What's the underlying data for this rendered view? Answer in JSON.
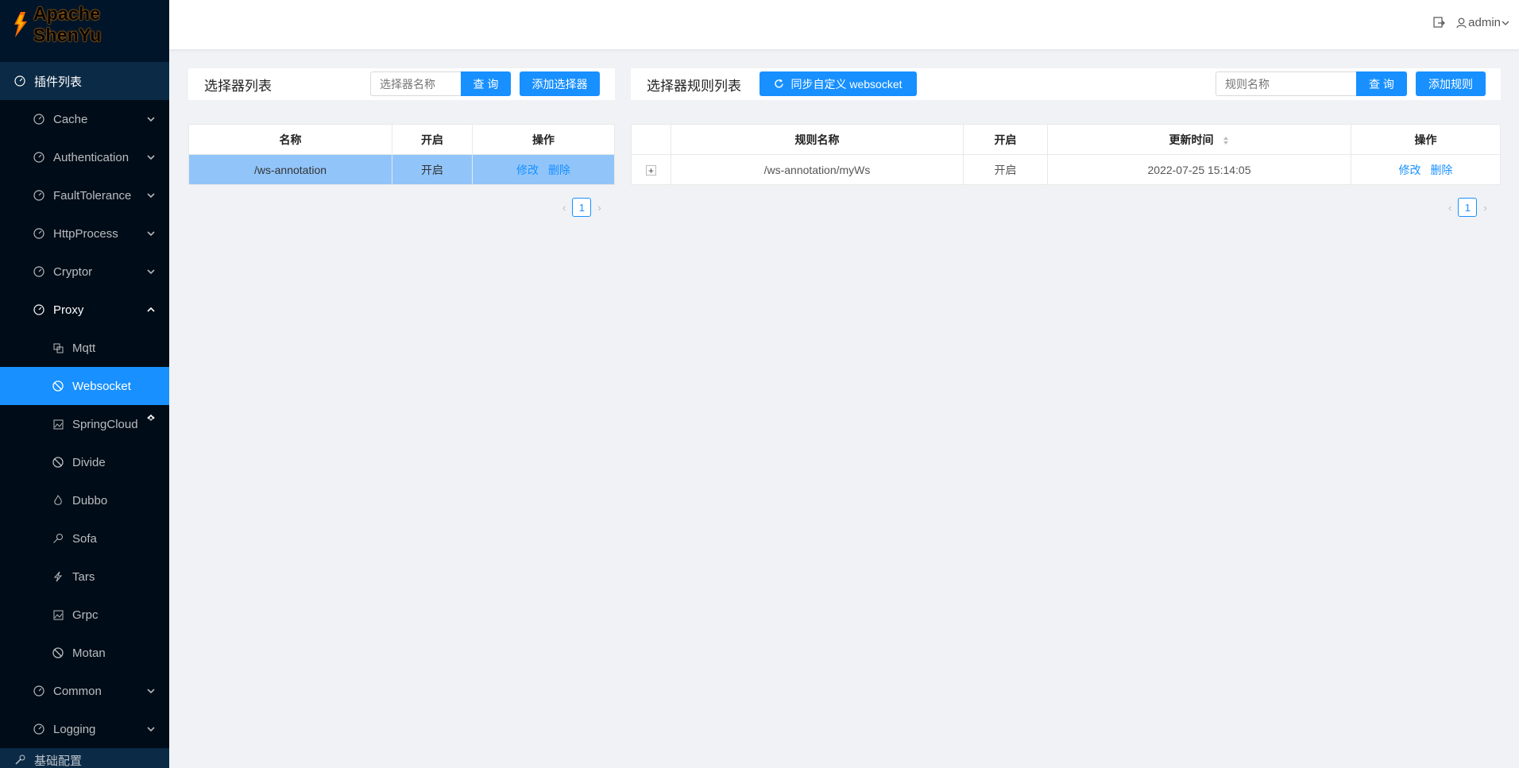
{
  "app": {
    "logo_text": "Apache ShenYu"
  },
  "header": {
    "user": "admin"
  },
  "sidebar": {
    "root": {
      "label": "插件列表"
    },
    "groups": [
      {
        "label": "Cache"
      },
      {
        "label": "Authentication"
      },
      {
        "label": "FaultTolerance"
      },
      {
        "label": "HttpProcess"
      },
      {
        "label": "Cryptor"
      },
      {
        "label": "Proxy"
      }
    ],
    "proxy_items": [
      {
        "label": "Mqtt"
      },
      {
        "label": "Websocket"
      },
      {
        "label": "SpringCloud"
      },
      {
        "label": "Divide"
      },
      {
        "label": "Dubbo"
      },
      {
        "label": "Sofa"
      },
      {
        "label": "Tars"
      },
      {
        "label": "Grpc"
      },
      {
        "label": "Motan"
      }
    ],
    "after_groups": [
      {
        "label": "Common"
      },
      {
        "label": "Logging"
      }
    ],
    "bottom": {
      "label": "基础配置"
    }
  },
  "selector": {
    "title": "选择器列表",
    "search_placeholder": "选择器名称",
    "search_label": "查 询",
    "add_label": "添加选择器",
    "columns": [
      "名称",
      "开启",
      "操作"
    ],
    "rows": [
      {
        "name": "/ws-annotation",
        "enabled": "开启",
        "edit": "修改",
        "delete": "删除"
      }
    ],
    "page": "1"
  },
  "rules": {
    "title": "选择器规则列表",
    "sync_label": "同步自定义 websocket",
    "search_placeholder": "规则名称",
    "search_label": "查 询",
    "add_label": "添加规则",
    "columns": [
      "规则名称",
      "开启",
      "更新时间",
      "操作"
    ],
    "rows": [
      {
        "expand": "+",
        "name": "/ws-annotation/myWs",
        "enabled": "开启",
        "updated": "2022-07-25 15:14:05",
        "edit": "修改",
        "delete": "删除"
      }
    ],
    "page": "1"
  }
}
